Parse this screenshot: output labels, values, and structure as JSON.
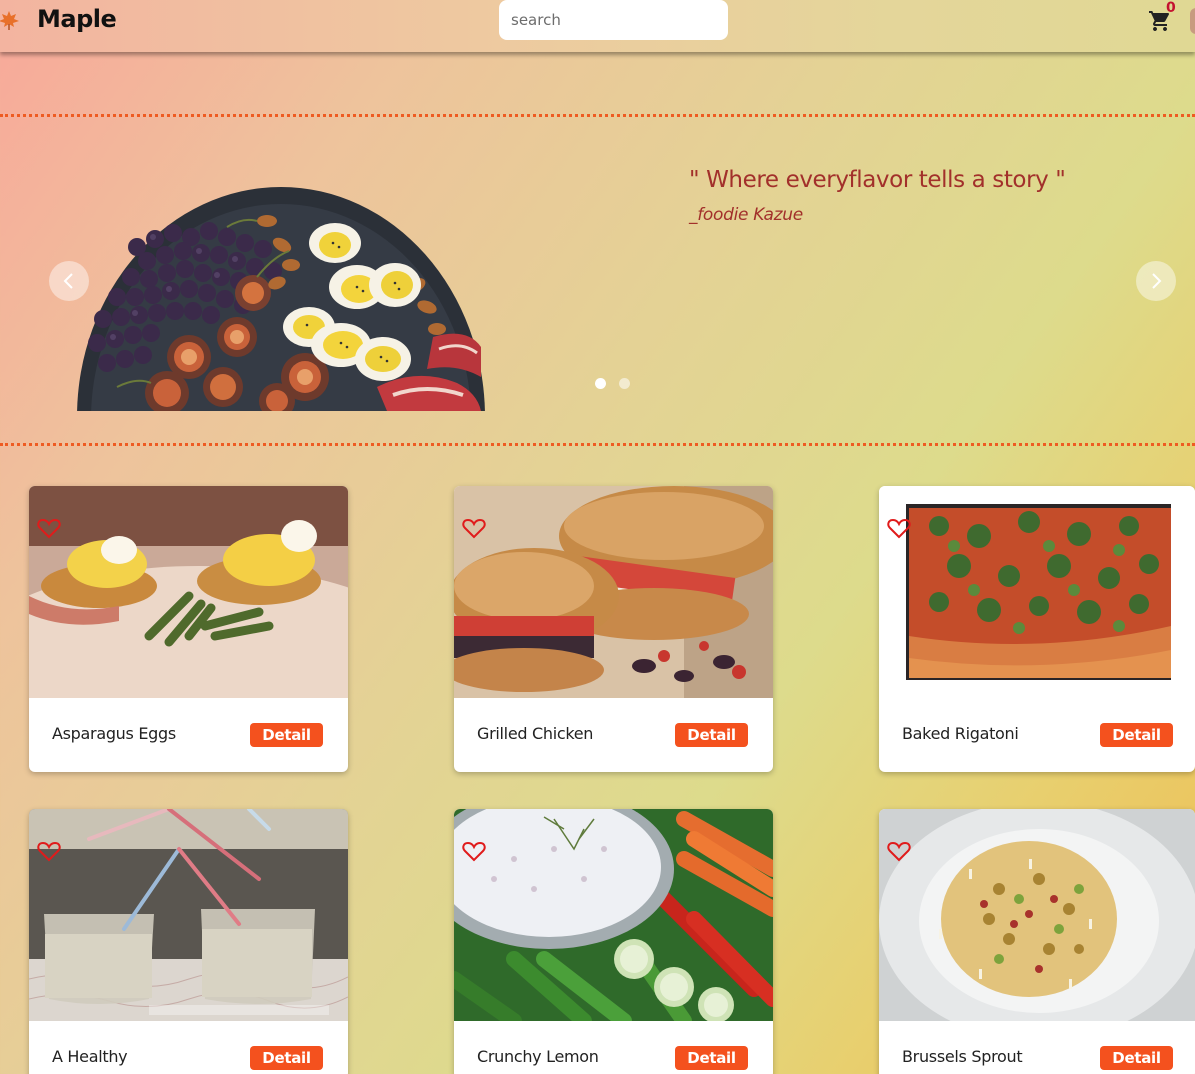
{
  "header": {
    "brand": "Maple",
    "logo_icon": "maple-leaf-icon",
    "search_placeholder": "search",
    "cart_icon": "shopping-cart-icon",
    "cart_count": "0"
  },
  "carousel": {
    "quote": "\" Where everyflavor tells a story \"",
    "author": "_foodie Kazue",
    "slides": 2,
    "active_slide": 1,
    "prev_icon": "chevron-left-icon",
    "next_icon": "chevron-right-icon",
    "divider_color": "#ee5b22",
    "quote_color": "#a2302b"
  },
  "cards": [
    {
      "title": "Asparagus Eggs",
      "button": "Detail"
    },
    {
      "title": "Grilled Chicken",
      "button": "Detail"
    },
    {
      "title": "Baked Rigatoni",
      "button": "Detail"
    },
    {
      "title": "A Healthy",
      "button": "Detail"
    },
    {
      "title": "Crunchy Lemon",
      "button": "Detail"
    },
    {
      "title": "Brussels Sprout",
      "button": "Detail"
    }
  ],
  "colors": {
    "accent": "#f4511e",
    "favorite": "#e01b1b"
  }
}
